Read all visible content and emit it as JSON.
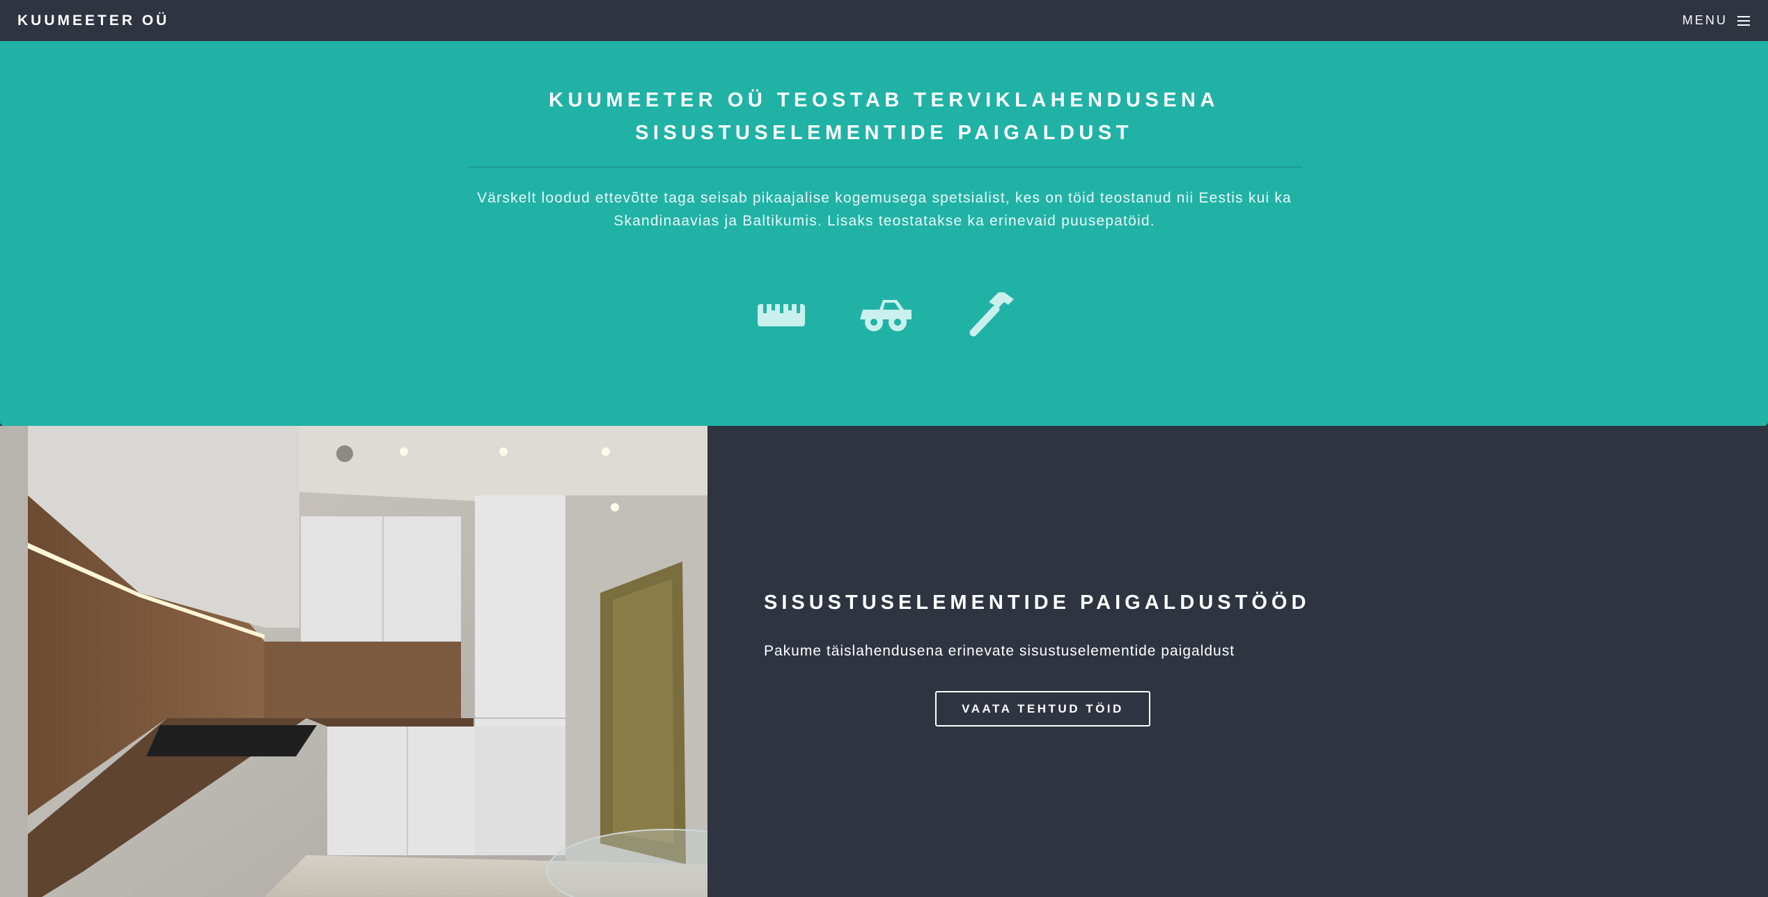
{
  "header": {
    "brand": "KUUMEETER OÜ",
    "menu_label": "MENU",
    "menu_icon": "hamburger-icon"
  },
  "banner": {
    "title_line1": "KUUMEETER OÜ TEOSTAB TERVIKLAHENDUSENA",
    "title_line2": "SISUSTUSELEMENTIDE PAIGALDUST",
    "text_line1": "Värskelt loodud ettevõtte taga seisab pikaajalise kogemusega spetsialist, kes on töid teostanud nii Eestis kui ka",
    "text_line2": "Skandinaavias ja Baltikumis. Lisaks teostatakse ka erinevaid puusepatöid.",
    "icons": [
      "ruler-icon",
      "truck-icon",
      "hammer-icon"
    ],
    "bg_color": "#21b2a6",
    "icon_color": "#c9f0ec"
  },
  "spotlight": {
    "image": "kitchen-photo",
    "title": "SISUSTUSELEMENTIDE PAIGALDUSTÖÖD",
    "text": "Pakume täislahendusena erinevate sisustuselementide paigaldust",
    "button_label": "VAATA TEHTUD TÖID",
    "bg_color": "#2e3440"
  }
}
